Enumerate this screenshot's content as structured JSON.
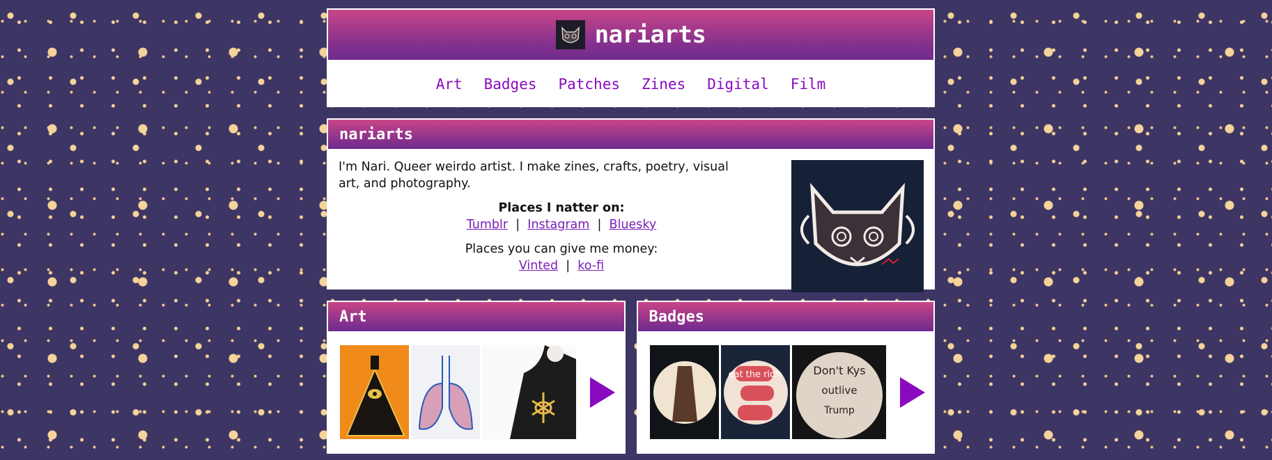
{
  "header": {
    "title": "nariarts",
    "logo_icon": "cat-face-icon"
  },
  "nav": {
    "items": [
      "Art",
      "Badges",
      "Patches",
      "Zines",
      "Digital",
      "Film"
    ]
  },
  "about": {
    "heading": "nariarts",
    "intro": "I'm Nari. Queer weirdo artist. I make zines, crafts, poetry, visual art, and photography.",
    "social_heading": "Places I natter on:",
    "social_links": [
      "Tumblr",
      "Instagram",
      "Bluesky"
    ],
    "money_heading": "Places you can give me money:",
    "money_links": [
      "Vinted",
      "ko-fi"
    ]
  },
  "sections": {
    "art": {
      "heading": "Art"
    },
    "badges": {
      "heading": "Badges"
    }
  },
  "badge_texts": {
    "b2": "eat the rich",
    "b3_line1": "Don't Kys",
    "b3_line2": "outlive",
    "b3_line3": "Trump"
  },
  "colors": {
    "accent": "#8a0ac0",
    "header_top": "#c94586",
    "header_bottom": "#6f2c8e",
    "background": "#3d3563"
  }
}
